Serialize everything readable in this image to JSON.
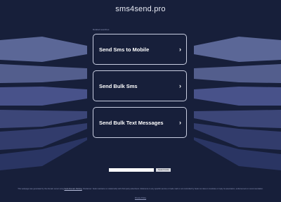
{
  "header": {
    "domain": "sms4send.pro"
  },
  "related": {
    "heading": "Related searches"
  },
  "links": [
    {
      "label": "Send Sms to Mobile"
    },
    {
      "label": "Send Bulk Sms"
    },
    {
      "label": "Send Bulk Text Messages"
    }
  ],
  "search": {
    "placeholder": "",
    "button_label": "Search Ads"
  },
  "footer": {
    "disclaimer_before": "This webpage was generated by the domain owner using ",
    "disclaimer_link": "Sedo Domain Parking",
    "disclaimer_after": ". Disclaimer: Sedo maintains no relationship with third party advertisers. Reference to any specific service or trade mark is not controlled by Sedo nor does it constitute or imply its association, endorsement or recommendation.",
    "privacy": "Privacy Policy"
  },
  "colors": {
    "background": "#171f3a",
    "band_light": "#5b6797",
    "band_dark": "#2a3563",
    "tile_border": "#c8cde0"
  },
  "icons": {
    "chevron": "›"
  }
}
